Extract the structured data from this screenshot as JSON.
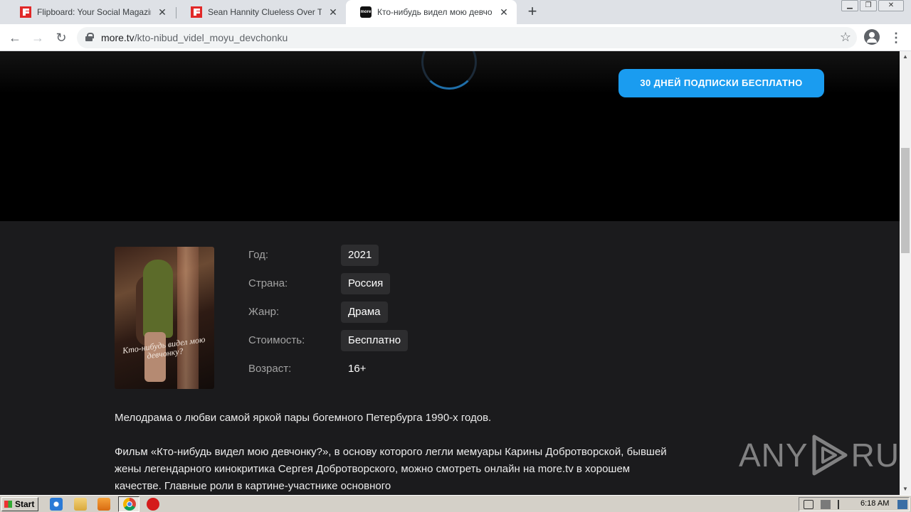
{
  "browser": {
    "tabs": [
      {
        "title": "Flipboard: Your Social Magazine",
        "icon": "flipboard-icon",
        "active": false
      },
      {
        "title": "Sean Hannity Clueless Over Tucker C",
        "icon": "flipboard-icon",
        "active": false
      },
      {
        "title": "Кто-нибудь видел мою девчонку?",
        "icon": "more-tv-icon",
        "active": true
      }
    ],
    "close_glyph": "✕",
    "new_tab_glyph": "+",
    "url_host": "more.tv",
    "url_path": "/kto-nibud_videl_moyu_devchonku"
  },
  "page": {
    "promo_button": "30 ДНЕЙ ПОДПИСКИ БЕСПЛАТНО",
    "poster_title": "Кто-нибудь видел мою девчонку?",
    "details": [
      {
        "label": "Год:",
        "value": "2021"
      },
      {
        "label": "Страна:",
        "value": "Россия"
      },
      {
        "label": "Жанр:",
        "value": "Драма"
      },
      {
        "label": "Стоимость:",
        "value": "Бесплатно"
      },
      {
        "label": "Возраст:",
        "value": "16+"
      }
    ],
    "description": [
      "Мелодрама о любви самой яркой пары богемного Петербурга 1990-х годов.",
      "Фильм «Кто-нибудь видел мою девчонку?», в основу которого легли мемуары Карины Добротворской, бывшей жены легендарного кинокритика Сергея Добротворского, можно смотреть онлайн на more.tv в хорошем качестве. Главные роли в картине-участнике основного"
    ],
    "watermark_left": "ANY",
    "watermark_right": "RUN"
  },
  "taskbar": {
    "start_label": "Start",
    "clock": "6:18 AM"
  },
  "colors": {
    "accent": "#1a9cf0",
    "page_bg": "#1b1b1d",
    "player_bg": "#000000"
  }
}
